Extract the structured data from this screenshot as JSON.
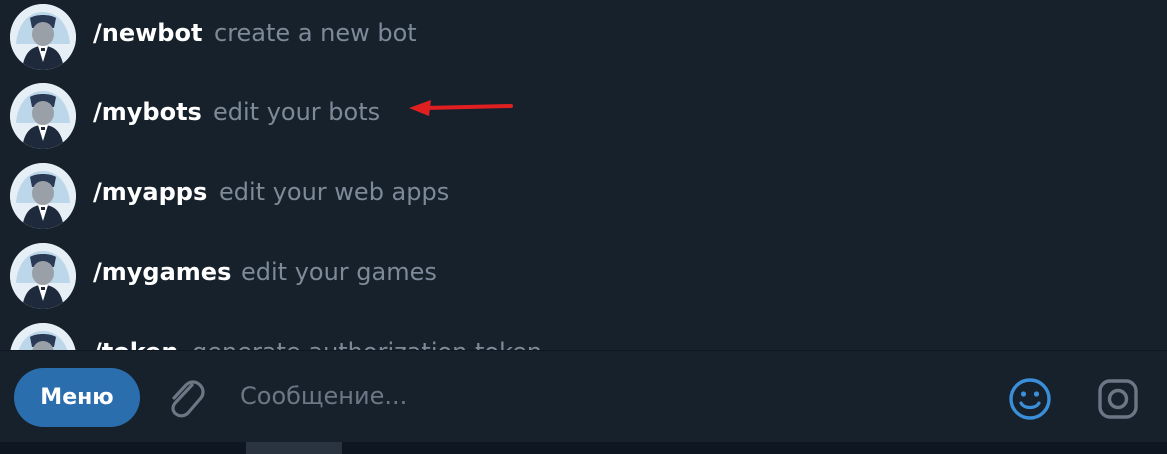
{
  "commands": [
    {
      "name": "/newbot",
      "description": "create a new bot"
    },
    {
      "name": "/mybots",
      "description": "edit your bots"
    },
    {
      "name": "/myapps",
      "description": "edit your web apps"
    },
    {
      "name": "/mygames",
      "description": "edit your games"
    },
    {
      "name": "/token",
      "description": "generate authorization token"
    }
  ],
  "composer": {
    "menu_label": "Меню",
    "placeholder": "Сообщение..."
  },
  "icons": {
    "attach": "paperclip-icon",
    "emoji": "smile-icon",
    "camera": "camera-icon"
  },
  "colors": {
    "background": "#17212b",
    "accent": "#2b6eae",
    "emoji_accent": "#3a8fd8",
    "description_text": "#7d8a98",
    "annotation_arrow": "#e02020"
  }
}
